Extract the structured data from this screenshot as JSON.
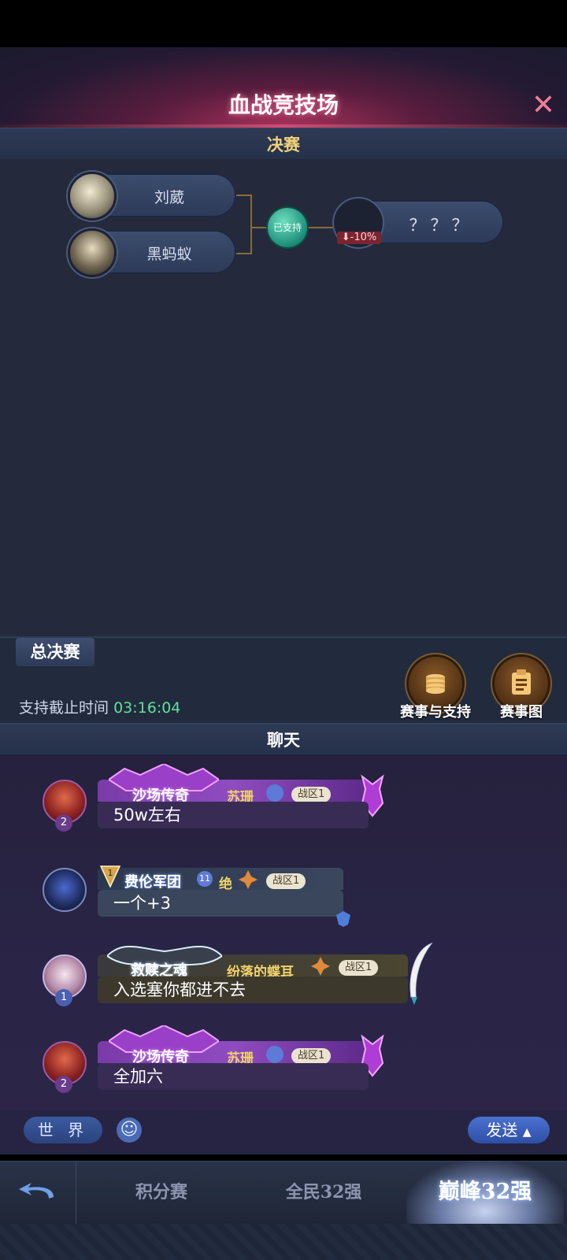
{
  "header": {
    "title": "血战竞技场",
    "close_icon": "close-icon"
  },
  "bracket": {
    "section_label": "决赛",
    "player1": "刘葳",
    "player2": "黑蚂蚁",
    "supported_label": "已支持",
    "winner_label": "？？？",
    "odds_change": "-10%"
  },
  "final": {
    "tag": "总决赛",
    "deadline_label": "支持截止时间",
    "deadline_time": "03:16:04",
    "support_button": "赛事与支持",
    "chart_button": "赛事图"
  },
  "chat": {
    "section_label": "聊天",
    "messages": [
      {
        "guild": "沙场传奇",
        "player": "苏珊",
        "zone": "战区1",
        "level": "2",
        "text": "50w左右"
      },
      {
        "guild": "费伦军团",
        "player": "绝",
        "zone": "战区1",
        "level": "1",
        "text": "一个+3"
      },
      {
        "guild": "救赎之魂",
        "player": "纷落的蝶耳",
        "zone": "战区1",
        "level": "1",
        "text": "入选塞你都进不去"
      },
      {
        "guild": "沙场传奇",
        "player": "苏珊",
        "zone": "战区1",
        "level": "2",
        "text": "全加六"
      }
    ],
    "channel": "世 界",
    "send_label": "发送"
  },
  "nav": {
    "tab1": "积分赛",
    "tab2": "全民32强",
    "tab3": "巅峰32强"
  }
}
